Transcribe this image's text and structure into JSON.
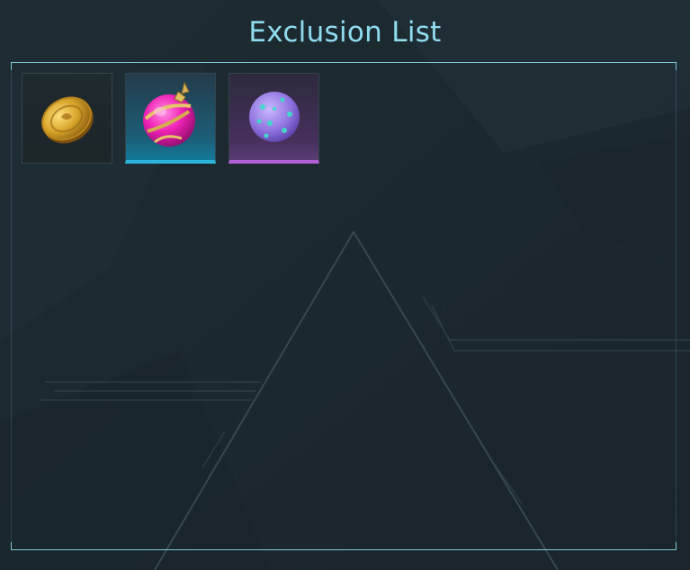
{
  "header": {
    "title": "Exclusion List"
  },
  "items": [
    {
      "icon": "gold-coin-icon",
      "rarity": "common"
    },
    {
      "icon": "pink-gem-orb-icon",
      "rarity": "rare"
    },
    {
      "icon": "spiked-purple-orb-icon",
      "rarity": "epic"
    }
  ],
  "colors": {
    "background": "#1c2a31",
    "title": "#8fdcef",
    "frame": "#7fc6d7",
    "rare_accent": "#2db3dc",
    "epic_accent": "#b25ed6"
  }
}
